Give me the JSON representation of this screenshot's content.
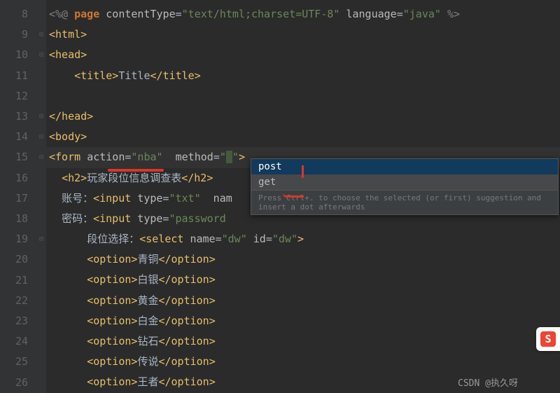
{
  "lines": {
    "start": 8,
    "items": [
      {
        "html": "<span class='dim'>&lt;%@</span> <span class='kw'>page</span> <span class='attr'>contentType</span><span class='txt'>=</span><span class='str'>\"text/html;charset=UTF-8\"</span> <span class='attr'>language</span><span class='txt'>=</span><span class='str'>\"java\"</span> <span class='dim'>%&gt;</span>",
        "fold": ""
      },
      {
        "html": "<span class='tag'>&lt;html&gt;</span>",
        "fold": "⊟"
      },
      {
        "html": "<span class='tag'>&lt;head&gt;</span>",
        "fold": "⊟"
      },
      {
        "html": "    <span class='tag'>&lt;title&gt;</span><span class='txt'>Title</span><span class='tag'>&lt;/title&gt;</span>",
        "fold": ""
      },
      {
        "html": "",
        "fold": ""
      },
      {
        "html": "<span class='tag'>&lt;/head&gt;</span>",
        "fold": "⊟"
      },
      {
        "html": "<span class='tag'>&lt;body&gt;</span>",
        "fold": "⊟"
      },
      {
        "html": "<span class='tag'>&lt;form </span><span class='attr'>action</span><span class='txt'>=</span><span class='str'>\"nba\"</span>  <span class='attr'>method</span><span class='txt'>=</span><span class='str'>\"</span><span class='caret-bg'> </span><span class='str'>\"</span><span class='tag'>&gt;</span>",
        "fold": "⊟",
        "current": true
      },
      {
        "html": "  <span class='tag'>&lt;h2&gt;</span><span class='txt'>玩家段位信息调查表</span><span class='tag'>&lt;/h2&gt;</span>",
        "fold": ""
      },
      {
        "html": "  <span class='txt'>账号：</span><span class='tag'>&lt;input </span><span class='attr'>type</span><span class='txt'>=</span><span class='str'>\"txt\"</span>  <span class='attr'>nam</span>",
        "fold": ""
      },
      {
        "html": "  <span class='txt'>密码：</span><span class='tag'>&lt;input </span><span class='attr'>type</span><span class='txt'>=</span><span class='str'>\"password</span>",
        "fold": ""
      },
      {
        "html": "      <span class='txt'>段位选择：</span><span class='tag'>&lt;select </span><span class='attr'>name</span><span class='txt'>=</span><span class='str'>\"dw\"</span> <span class='attr'>id</span><span class='txt'>=</span><span class='str'>\"dw\"</span><span class='tag'>&gt;</span>",
        "fold": "⊟"
      },
      {
        "html": "      <span class='tag'>&lt;option&gt;</span><span class='txt'>青铜</span><span class='tag'>&lt;/option&gt;</span>",
        "fold": ""
      },
      {
        "html": "      <span class='tag'>&lt;option&gt;</span><span class='txt'>白银</span><span class='tag'>&lt;/option&gt;</span>",
        "fold": ""
      },
      {
        "html": "      <span class='tag'>&lt;option&gt;</span><span class='txt'>黄金</span><span class='tag'>&lt;/option&gt;</span>",
        "fold": ""
      },
      {
        "html": "      <span class='tag'>&lt;option&gt;</span><span class='txt'>白金</span><span class='tag'>&lt;/option&gt;</span>",
        "fold": ""
      },
      {
        "html": "      <span class='tag'>&lt;option&gt;</span><span class='txt'>钻石</span><span class='tag'>&lt;/option&gt;</span>",
        "fold": ""
      },
      {
        "html": "      <span class='tag'>&lt;option&gt;</span><span class='txt'>传说</span><span class='tag'>&lt;/option&gt;</span>",
        "fold": ""
      },
      {
        "html": "      <span class='tag'>&lt;option&gt;</span><span class='txt'>王者</span><span class='tag'>&lt;/option&gt;</span>",
        "fold": ""
      }
    ]
  },
  "popup": {
    "items": [
      "post",
      "get"
    ],
    "selected": 0,
    "hint": "Press Ctrl+. to choose the selected (or first) suggestion and insert a dot afterwards"
  },
  "watermark": "CSDN @执久呀",
  "badge": "S"
}
